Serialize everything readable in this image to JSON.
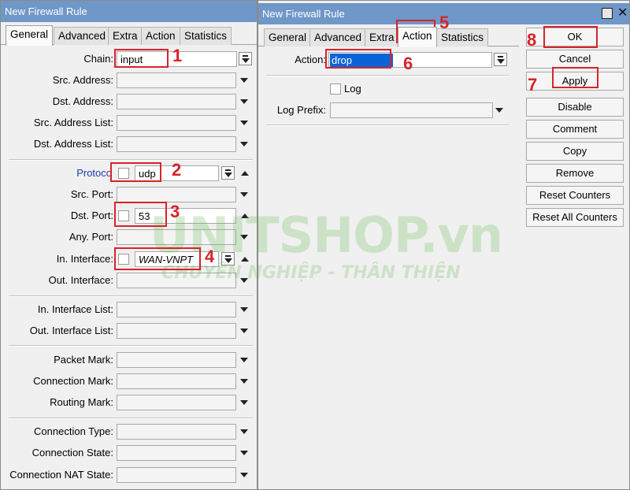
{
  "left_window": {
    "title": "New Firewall Rule",
    "tabs": [
      "General",
      "Advanced",
      "Extra",
      "Action",
      "Statistics"
    ],
    "fields": {
      "chain": {
        "label": "Chain:",
        "value": "input"
      },
      "src_address": {
        "label": "Src. Address:"
      },
      "dst_address": {
        "label": "Dst. Address:"
      },
      "src_address_list": {
        "label": "Src. Address List:"
      },
      "dst_address_list": {
        "label": "Dst. Address List:"
      },
      "protocol": {
        "label": "Protoco",
        "value": "udp"
      },
      "src_port": {
        "label": "Src. Port:"
      },
      "dst_port": {
        "label": "Dst. Port:",
        "value": "53"
      },
      "any_port": {
        "label": "Any. Port:"
      },
      "in_interface": {
        "label": "In. Interface:",
        "value": "WAN-VNPT"
      },
      "out_interface": {
        "label": "Out. Interface:"
      },
      "in_interface_list": {
        "label": "In. Interface List:"
      },
      "out_interface_list": {
        "label": "Out. Interface List:"
      },
      "packet_mark": {
        "label": "Packet Mark:"
      },
      "connection_mark": {
        "label": "Connection Mark:"
      },
      "routing_mark": {
        "label": "Routing Mark:"
      },
      "connection_type": {
        "label": "Connection Type:"
      },
      "connection_state": {
        "label": "Connection State:"
      },
      "connection_nat_state": {
        "label": "Connection NAT State:"
      }
    }
  },
  "right_window": {
    "title": "New Firewall Rule",
    "tabs": [
      "General",
      "Advanced",
      "Extra",
      "Action",
      "Statistics"
    ],
    "action": {
      "label": "Action:",
      "value": "drop"
    },
    "log": {
      "label": "Log"
    },
    "log_prefix": {
      "label": "Log Prefix:"
    },
    "buttons": [
      "OK",
      "Cancel",
      "Apply",
      "Disable",
      "Comment",
      "Copy",
      "Remove",
      "Reset Counters",
      "Reset All Counters"
    ]
  },
  "annotations": [
    "1",
    "2",
    "3",
    "4",
    "5",
    "6",
    "7",
    "8"
  ],
  "watermark": {
    "brand": "UNITSHOP.vn",
    "slogan": "CHUYÊN NGHIỆP - THÂN THIỆN"
  },
  "colors": {
    "titlebar": "#6f97c8",
    "highlight_red": "#d8232a",
    "selection_blue": "#0a64d8",
    "label_blue": "#1f3ca8"
  }
}
